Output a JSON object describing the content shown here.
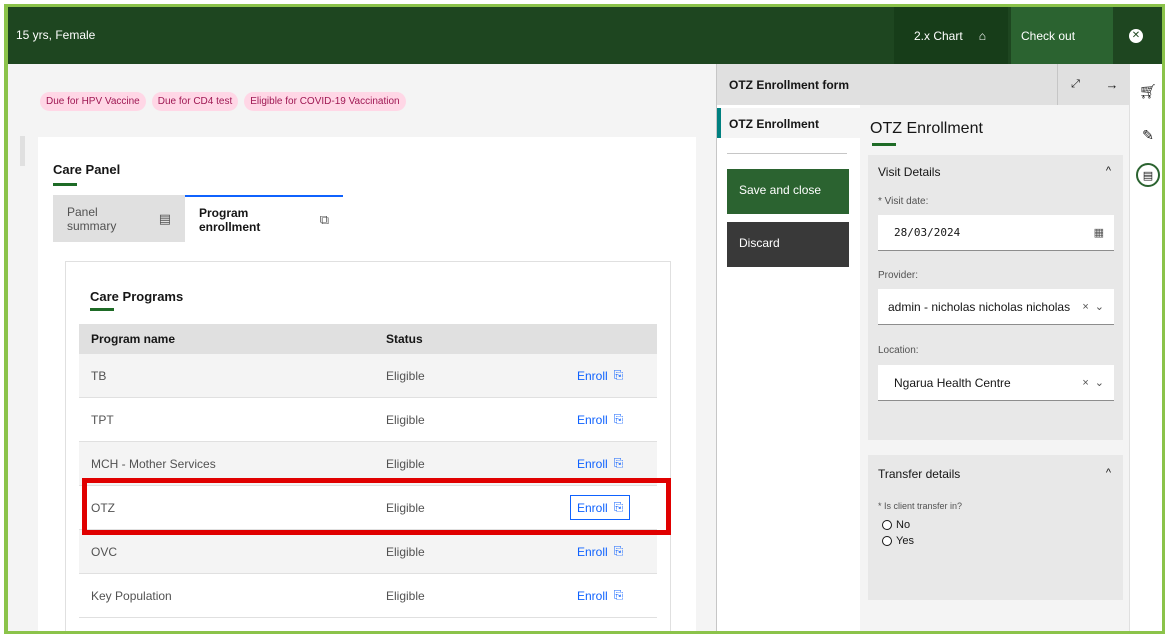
{
  "topbar": {
    "patient": "15 yrs, Female",
    "chart_label": "2.x Chart",
    "checkout_label": "Check out"
  },
  "alerts": [
    "Due for HPV Vaccine",
    "Due for CD4 test",
    "Eligible for COVID-19 Vaccination"
  ],
  "care_panel": {
    "title": "Care Panel",
    "tabs": [
      {
        "label": "Panel summary",
        "icon": "table-icon"
      },
      {
        "label": "Program enrollment",
        "icon": "enroll-icon"
      }
    ],
    "programs_title": "Care Programs",
    "columns": [
      "Program name",
      "Status",
      ""
    ],
    "rows": [
      {
        "program": "TB",
        "status": "Eligible",
        "action": "Enroll"
      },
      {
        "program": "TPT",
        "status": "Eligible",
        "action": "Enroll"
      },
      {
        "program": "MCH - Mother Services",
        "status": "Eligible",
        "action": "Enroll"
      },
      {
        "program": "OTZ",
        "status": "Eligible",
        "action": "Enroll"
      },
      {
        "program": "OVC",
        "status": "Eligible",
        "action": "Enroll"
      },
      {
        "program": "Key Population",
        "status": "Eligible",
        "action": "Enroll"
      }
    ],
    "highlight_color": "#e00000"
  },
  "workspace": {
    "title": "OTZ Enrollment form",
    "nav_item": "OTZ Enrollment",
    "save_label": "Save and close",
    "discard_label": "Discard",
    "form_title": "OTZ Enrollment",
    "visit_details": {
      "heading": "Visit Details",
      "visit_date_label": "* Visit date:",
      "visit_date": "28/03/2024",
      "provider_label": "Provider:",
      "provider": "admin - nicholas nicholas nicholas",
      "location_label": "Location:",
      "location": "Ngarua Health Centre"
    },
    "transfer": {
      "heading": "Transfer details",
      "question": "* Is client transfer in?",
      "options": [
        "No",
        "Yes"
      ]
    }
  },
  "colors": {
    "brand": "#1e4620",
    "accent": "#2b6330",
    "link": "#0f62fe",
    "frame": "#8bc34a"
  }
}
